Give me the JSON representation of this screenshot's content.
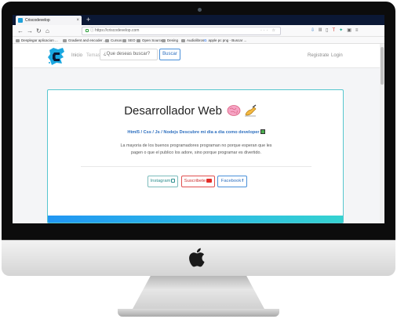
{
  "browser": {
    "tab_title": "Criscodevelop",
    "tab_close": "×",
    "new_tab": "+",
    "url": "https://criscodevelop.com",
    "url_actions": "··· ☆",
    "bookmarks": [
      {
        "label": "Desplegar aplicacion ..."
      },
      {
        "label": "Gradient and encoder ..."
      },
      {
        "label": "Cursos"
      },
      {
        "label": "SEO"
      },
      {
        "label": "Open Source"
      },
      {
        "label": "Desing"
      },
      {
        "label": "Audiolibros"
      },
      {
        "label": "apple pc png - Buscar ..."
      }
    ]
  },
  "site": {
    "nav_home": "Inicio",
    "nav_topics": "Temas",
    "search_placeholder": "¿Que deseas buscar?",
    "search_button": "Buscar",
    "register": "Registrate",
    "login": "Login"
  },
  "hero": {
    "title": "Desarrollador Web",
    "subtitle": "Html5 / Css / Js / Nodejs Descubre mi dia a dia como developer",
    "description": "La mayoria de los buenos programadores programan no porque esperan que les pagen o que el publico los adore, sino porque programar es divertido.",
    "buttons": {
      "instagram": "Instagram",
      "youtube": "Suscribete",
      "facebook": "Facebook"
    }
  },
  "colors": {
    "accent": "#2d6fbf",
    "card_border": "#56c6cf",
    "band_start": "#2196f3",
    "band_end": "#35d3d0"
  }
}
